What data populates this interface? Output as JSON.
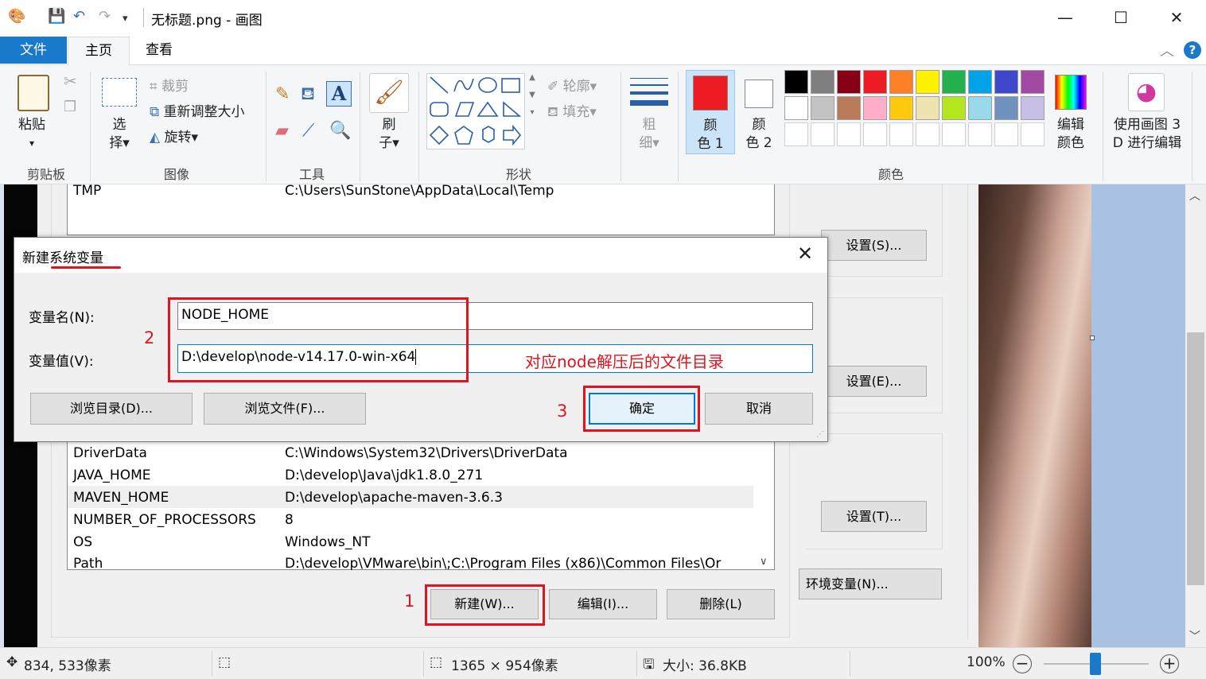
{
  "window": {
    "title": "无标题.png - 画图",
    "minimize": "—",
    "maximize": "☐",
    "close": "✕"
  },
  "tabs": {
    "file": "文件",
    "home": "主页",
    "view": "查看"
  },
  "ribbon": {
    "clipboard": {
      "group": "剪贴板",
      "paste_l1": "粘贴",
      "paste_l2": "▾"
    },
    "image": {
      "group": "图像",
      "select_l1": "选",
      "select_l2": "择▾",
      "crop": "裁剪",
      "resize": "重新调整大小",
      "rotate": "旋转▾"
    },
    "tools": {
      "group": "工具"
    },
    "brushes": {
      "l1": "刷",
      "l2": "子▾"
    },
    "shapes": {
      "group": "形状",
      "outline": "轮廓▾",
      "fill": "填充▾"
    },
    "size": {
      "l1": "粗",
      "l2": "细▾"
    },
    "colors": {
      "group": "颜色",
      "color1_l1": "颜",
      "color1_l2": "色 1",
      "color2_l1": "颜",
      "color2_l2": "色 2",
      "edit_l1": "编辑",
      "edit_l2": "颜色",
      "paint3d_l1": "使用画图 3",
      "paint3d_l2": "D 进行编辑",
      "color1_value": "#ed1c24",
      "color2_value": "#ffffff",
      "palette_row1": [
        "#000000",
        "#7f7f7f",
        "#880015",
        "#ed1c24",
        "#ff7f27",
        "#fff200",
        "#22b14c",
        "#00a2e8",
        "#3f48cc",
        "#a349a4"
      ],
      "palette_row2": [
        "#ffffff",
        "#c3c3c3",
        "#b97a57",
        "#ffaec9",
        "#ffc90e",
        "#efe4b0",
        "#b5e61d",
        "#99d9ea",
        "#7092be",
        "#c8bfe7"
      ],
      "palette_row3": [
        "#ffffff",
        "#ffffff",
        "#ffffff",
        "#ffffff",
        "#ffffff",
        "#ffffff",
        "#ffffff",
        "#ffffff",
        "#ffffff",
        "#ffffff"
      ]
    }
  },
  "env": {
    "top_row": {
      "name": "TMP",
      "value": "C:\\Users\\SunStone\\AppData\\Local\\Temp"
    },
    "sys_vars": [
      {
        "name": "DriverData",
        "value": "C:\\Windows\\System32\\Drivers\\DriverData"
      },
      {
        "name": "JAVA_HOME",
        "value": "D:\\develop\\Java\\jdk1.8.0_271"
      },
      {
        "name": "MAVEN_HOME",
        "value": "D:\\develop\\apache-maven-3.6.3"
      },
      {
        "name": "NUMBER_OF_PROCESSORS",
        "value": "8"
      },
      {
        "name": "OS",
        "value": "Windows_NT"
      },
      {
        "name": "Path",
        "value": "D:\\develop\\VMware\\bin\\;C:\\Program Files (x86)\\Common Files\\Or"
      }
    ],
    "new_button": "新建(W)...",
    "edit_button": "编辑(I)...",
    "delete_button": "删除(L)",
    "settings_s": "设置(S)...",
    "settings_e": "设置(E)...",
    "settings_t": "设置(T)...",
    "env_vars_button": "环境变量(N)..."
  },
  "dialog": {
    "title": "新建系统变量",
    "var_name_label": "变量名(N):",
    "var_name_value": "NODE_HOME",
    "var_value_label": "变量值(V):",
    "var_value_value": "D:\\develop\\node-v14.17.0-win-x64",
    "browse_dir": "浏览目录(D)...",
    "browse_file": "浏览文件(F)...",
    "ok": "确定",
    "cancel": "取消",
    "annotation": "对应node解压后的文件目录"
  },
  "annotations": {
    "n1": "1",
    "n2": "2",
    "n3": "3"
  },
  "status": {
    "cursor": "834, 533像素",
    "dimensions": "1365 × 954像素",
    "size": "大小: 36.8KB",
    "zoom": "100%"
  }
}
